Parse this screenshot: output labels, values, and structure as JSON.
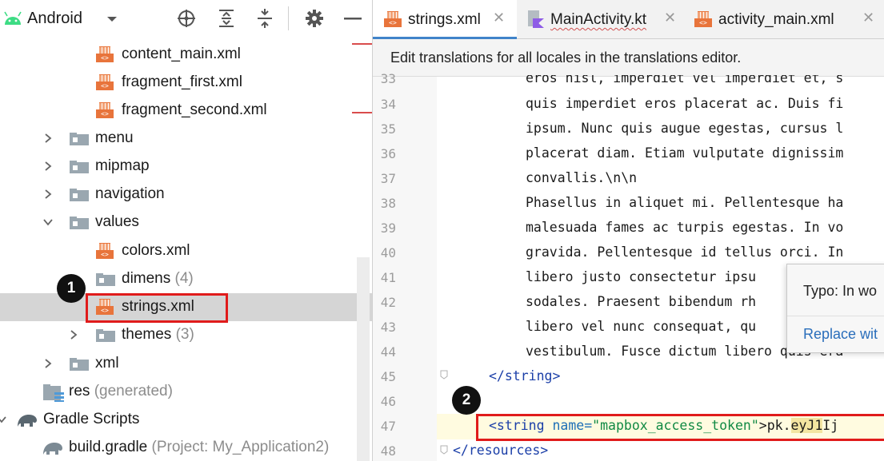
{
  "project_panel": {
    "view_selector": "Android",
    "tree": [
      {
        "label": "content_main.xml",
        "hint": "",
        "kind": "xml"
      },
      {
        "label": "fragment_first.xml",
        "hint": "",
        "kind": "xml"
      },
      {
        "label": "fragment_second.xml",
        "hint": "",
        "kind": "xml"
      },
      {
        "label": "menu",
        "hint": "",
        "kind": "folder"
      },
      {
        "label": "mipmap",
        "hint": "",
        "kind": "folder"
      },
      {
        "label": "navigation",
        "hint": "",
        "kind": "folder"
      },
      {
        "label": "values",
        "hint": "",
        "kind": "folder"
      },
      {
        "label": "colors.xml",
        "hint": "",
        "kind": "xml"
      },
      {
        "label": "dimens",
        "hint": "(4)",
        "kind": "folder"
      },
      {
        "label": "strings.xml",
        "hint": "",
        "kind": "xml"
      },
      {
        "label": "themes",
        "hint": "(3)",
        "kind": "folder"
      },
      {
        "label": "xml",
        "hint": "",
        "kind": "folder"
      },
      {
        "label": "res",
        "hint": "(generated)",
        "kind": "res"
      },
      {
        "label": "Gradle Scripts",
        "hint": "",
        "kind": "gradle"
      },
      {
        "label": "build.gradle",
        "hint": "(Project: My_Application2)",
        "kind": "gradle"
      }
    ]
  },
  "editor": {
    "tabs": [
      {
        "label": "strings.xml",
        "active": true
      },
      {
        "label": "MainActivity.kt",
        "active": false
      },
      {
        "label": "activity_main.xml",
        "active": false
      }
    ],
    "notification": "Edit translations for all locales in the translations editor.",
    "lines": [
      {
        "num": "33",
        "text": "eros nisl, imperdiet vel imperdiet et, s"
      },
      {
        "num": "34",
        "text": "quis imperdiet eros placerat ac. Duis fi"
      },
      {
        "num": "35",
        "text": "ipsum. Nunc quis augue egestas, cursus l"
      },
      {
        "num": "36",
        "text": "placerat diam. Etiam vulputate dignissim"
      },
      {
        "num": "37",
        "text": "convallis.\\n\\n"
      },
      {
        "num": "38",
        "text": "Phasellus in aliquet mi. Pellentesque ha"
      },
      {
        "num": "39",
        "text": "malesuada fames ac turpis egestas. In vo"
      },
      {
        "num": "40",
        "text": "gravida. Pellentesque id tellus orci. In"
      },
      {
        "num": "41",
        "text": "libero justo consectetur ipsu"
      },
      {
        "num": "42",
        "text": "sodales. Praesent bibendum rh"
      },
      {
        "num": "43",
        "text": "libero vel nunc consequat, qu"
      },
      {
        "num": "44",
        "text": "vestibulum. Fusce dictum libero quis era"
      },
      {
        "num": "45",
        "text": "</string>"
      },
      {
        "num": "46",
        "text": ""
      },
      {
        "num": "47",
        "text": "<string name=\"mapbox_access_token\">pk.eyJ1Ij"
      },
      {
        "num": "48",
        "text": "</resources>"
      }
    ],
    "line47": {
      "tag_open": "<string",
      "attr": "name=",
      "value": "\"mapbox_access_token\"",
      "close": ">pk.",
      "token_highlight": "eyJ1",
      "token_rest": "Ij"
    },
    "line45_tag": "</string>",
    "line48_tag": "</resources>"
  },
  "typo_popup": {
    "message": "Typo: In wo",
    "action": "Replace wit"
  },
  "annotations": {
    "badge_1": "1",
    "badge_2": "2"
  },
  "colors": {
    "highlight_red": "#e01b1b",
    "xml_orange": "#e8743b",
    "folder_gray": "#9aa7b0",
    "tag_blue": "#1b3fa8",
    "string_green": "#108a44",
    "active_tab_underline": "#4083c9"
  }
}
